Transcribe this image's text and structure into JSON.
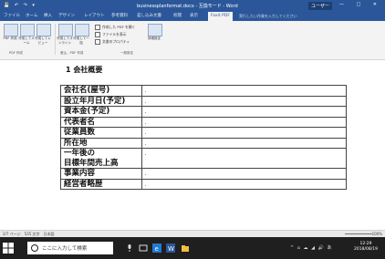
{
  "window": {
    "doc_title": "businessplanformat.docx - 互換モード - Word",
    "user": "ユーザー",
    "qa_icons": "💾 ↶ ↷ ▾"
  },
  "ribbon": {
    "tabs": [
      "ファイル",
      "ホーム",
      "挿入",
      "デザイン",
      "レイアウト",
      "参考資料",
      "差し込み文書",
      "校閲",
      "表示",
      "Foxit PDF"
    ],
    "active_tab": "Foxit PDF",
    "tell_me": "実行したい作業を入力してください",
    "buttons": [
      {
        "label": "PDF 作成"
      },
      {
        "label": "作成してメール"
      },
      {
        "label": "作成してレビュー"
      },
      {
        "label": "作成してオンライン"
      },
      {
        "label": "作成して一括"
      },
      {
        "label": "詳細設定"
      }
    ],
    "checks": [
      "作成した PDF を開く",
      "ファイルを表示",
      "文書のプロパティ"
    ],
    "groups": {
      "create": "PDF 作成",
      "create2": "差込、PDF 作成",
      "settings": "一般設定"
    }
  },
  "document": {
    "heading": "1 会社概要",
    "rows": [
      "会社名(屋号)",
      "設立年月日(予定)",
      "資本金(予定)",
      "代表者名",
      "従業員数",
      "所在地",
      "一年後の",
      "目標年間売上高",
      "事業内容",
      "経営者略歴"
    ]
  },
  "statusbar": {
    "left": "2/7 ページ　535 文字　日本語",
    "zoom": "100%"
  },
  "taskbar": {
    "search_text": "ここに入力して検索",
    "tray": "^ ⌂ ☁ ◢ 🔊 あ",
    "time": "12:29",
    "date": "2018/08/19"
  },
  "colors": {
    "word_blue": "#2b579a",
    "taskbar": "#1f1f1f"
  }
}
